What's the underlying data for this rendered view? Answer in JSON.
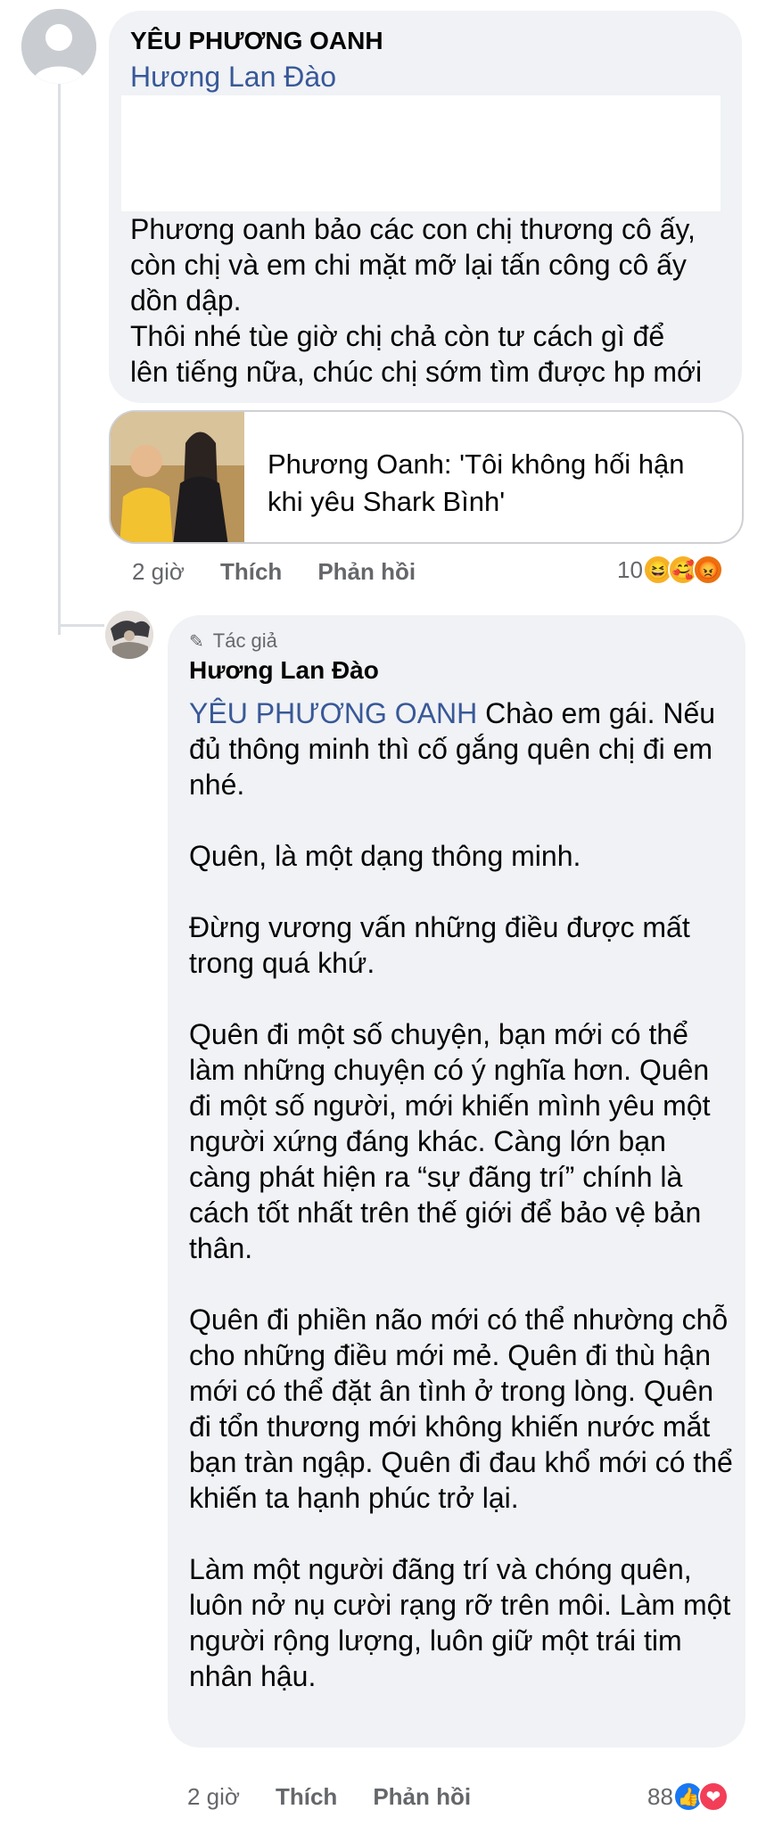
{
  "comment1": {
    "author": "YÊU PHƯƠNG OANH",
    "mention": "Hương Lan Đào",
    "lines": [
      "Phương oanh bảo các con chị thương cô ấy,",
      "còn chị và em chi mặt mỡ lại tấn công cô ấy",
      "dồn dập.",
      "Thôi nhé tùe giờ chị chả còn tư cách gì để",
      "lên tiếng nữa, chúc chị sớm tìm được hp mới"
    ],
    "link_card": {
      "title": "Phương Oanh: 'Tôi không hối hận khi yêu Shark Bình'"
    },
    "time": "2 giờ",
    "like_label": "Thích",
    "reply_label": "Phản hồi",
    "reaction_count": "10",
    "reactions": [
      "haha-icon",
      "care-icon",
      "angry-icon"
    ]
  },
  "reply1": {
    "badge": "Tác giả",
    "author": "Hương Lan Đào",
    "mention": "YÊU PHƯƠNG OANH",
    "first_text": " Chào em gái. Nếu đủ thông minh thì cố gắng quên chị đi em nhé.",
    "paragraphs": [
      "Quên, là một dạng thông minh.",
      "Đừng vương vấn những điều được mất trong quá khứ.",
      "Quên đi một số chuyện, bạn mới có thể làm những chuyện có ý nghĩa hơn. Quên đi một số người, mới khiến mình yêu một người xứng đáng khác. Càng lớn bạn càng phát hiện ra “sự đãng trí” chính là cách tốt nhất trên thế giới để bảo vệ bản thân.",
      "Quên đi phiền não mới có thể nhường chỗ cho những điều mới mẻ. Quên đi thù hận mới có thể đặt ân tình ở trong lòng. Quên đi tổn thương mới không khiến nước mắt bạn tràn ngập. Quên đi đau khổ mới có thể khiến ta hạnh phúc trở lại.",
      "Làm một người đãng trí và chóng quên, luôn nở nụ cười rạng rỡ trên môi. Làm một người rộng lượng, luôn giữ một trái tim nhân hậu."
    ],
    "time": "2 giờ",
    "like_label": "Thích",
    "reply_label": "Phản hồi",
    "reaction_count": "88",
    "reactions": [
      "like-icon",
      "love-icon"
    ]
  }
}
